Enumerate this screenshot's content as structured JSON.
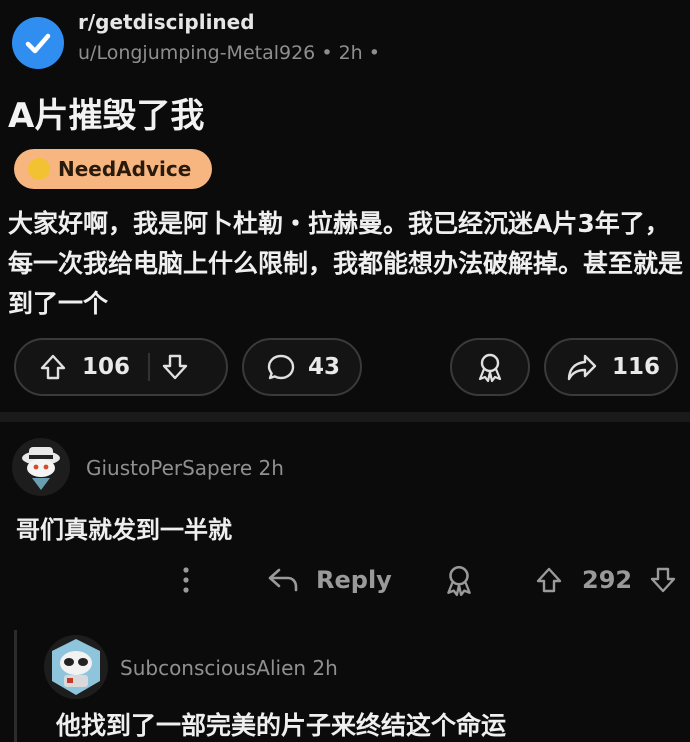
{
  "post": {
    "subreddit": "r/getdisciplined",
    "author": "u/Longjumping-Metal926",
    "age": "2h",
    "title": "A片摧毁了我",
    "flair": "NeedAdvice",
    "body": "大家好啊，我是阿卜杜勒・拉赫曼。我已经沉迷A片3年了，每一次我给电脑上什么限制，我都能想办法破解掉。甚至就是到了一个",
    "upvotes": "106",
    "comments": "43",
    "shares": "116"
  },
  "comment": {
    "username": "GiustoPerSapere",
    "age": "2h",
    "text": "哥们真就发到一半就",
    "reply_label": "Reply",
    "votes": "292"
  },
  "reply": {
    "username": "SubconsciousAlien",
    "age": "2h",
    "text": "他找到了一部完美的片子来终结这个命运"
  },
  "colors": {
    "background": "#0b0b0b",
    "flair": "#f7b57f",
    "subreddit_icon": "#2f8ef0"
  }
}
